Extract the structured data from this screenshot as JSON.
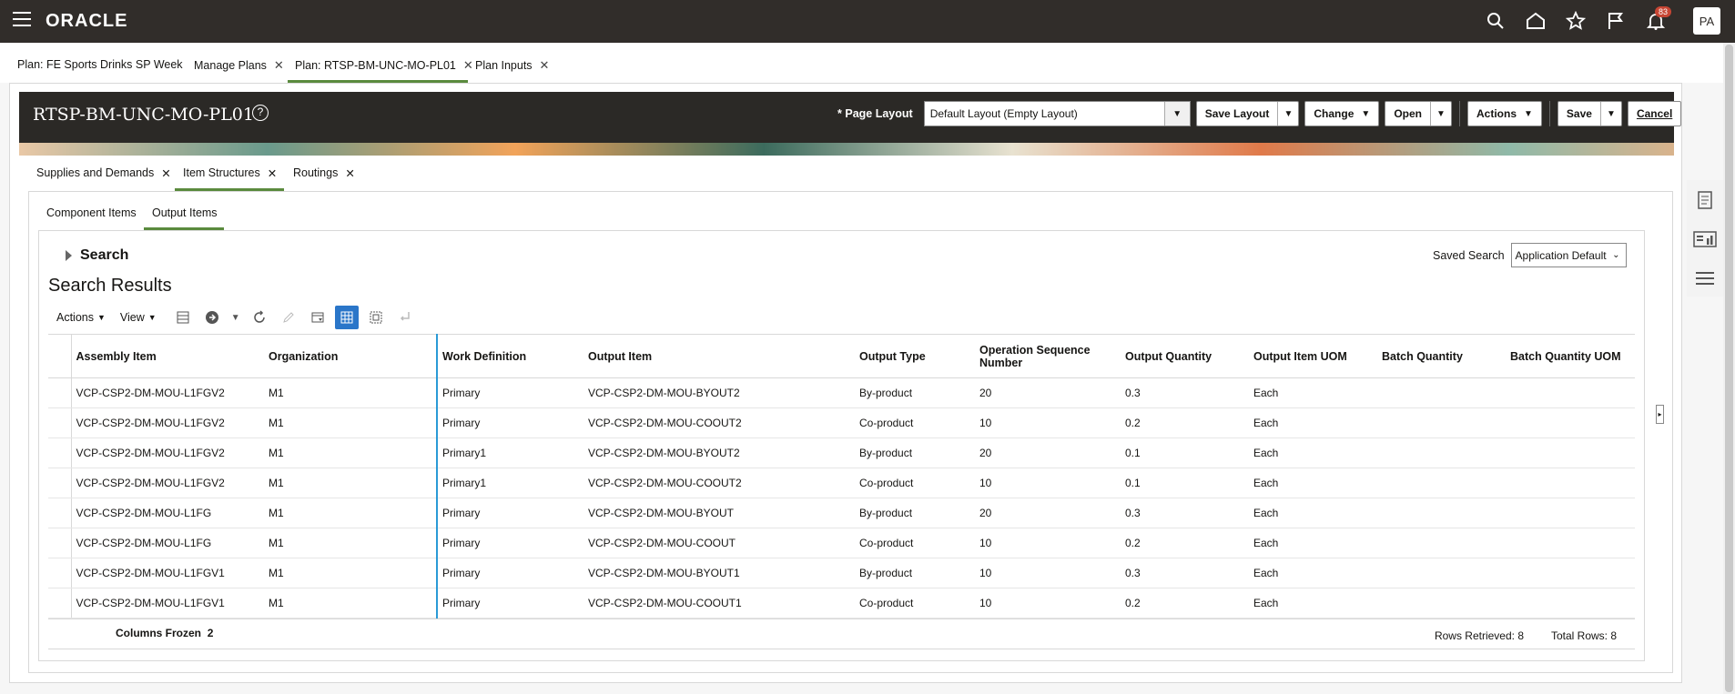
{
  "brand": "ORACLE",
  "notifications_count": "83",
  "user_initials": "PA",
  "plan_tabs": [
    {
      "label": "Plan: FE Sports Drinks SP Week",
      "closable": false
    },
    {
      "label": "Manage Plans",
      "closable": true
    },
    {
      "label": "Plan: RTSP-BM-UNC-MO-PL01",
      "closable": true
    },
    {
      "label": "Plan Inputs",
      "closable": true
    }
  ],
  "header": {
    "title": "RTSP-BM-UNC-MO-PL01",
    "page_layout_required": "*",
    "page_layout_label": "Page Layout",
    "page_layout_value": "Default Layout (Empty Layout)",
    "buttons": {
      "save_layout": "Save Layout",
      "change": "Change",
      "open": "Open",
      "actions": "Actions",
      "save": "Save",
      "cancel": "Cancel"
    }
  },
  "sub_tabs": [
    {
      "label": "Supplies and Demands"
    },
    {
      "label": "Item Structures"
    },
    {
      "label": "Routings"
    }
  ],
  "inner_tabs": [
    {
      "label": "Component Items"
    },
    {
      "label": "Output Items"
    }
  ],
  "search": {
    "label": "Search",
    "saved_search_label": "Saved Search",
    "saved_search_value": "Application Default"
  },
  "results": {
    "title": "Search Results",
    "toolbar": {
      "actions": "Actions",
      "view": "View"
    },
    "columns": [
      "Assembly Item",
      "Organization",
      "Work Definition",
      "Output Item",
      "Output Type",
      "Operation Sequence Number",
      "Output Quantity",
      "Output Item UOM",
      "Batch Quantity",
      "Batch Quantity UOM"
    ],
    "rows": [
      [
        "VCP-CSP2-DM-MOU-L1FGV2",
        "M1",
        "Primary",
        "VCP-CSP2-DM-MOU-BYOUT2",
        "By-product",
        "20",
        "0.3",
        "Each",
        "",
        ""
      ],
      [
        "VCP-CSP2-DM-MOU-L1FGV2",
        "M1",
        "Primary",
        "VCP-CSP2-DM-MOU-COOUT2",
        "Co-product",
        "10",
        "0.2",
        "Each",
        "",
        ""
      ],
      [
        "VCP-CSP2-DM-MOU-L1FGV2",
        "M1",
        "Primary1",
        "VCP-CSP2-DM-MOU-BYOUT2",
        "By-product",
        "20",
        "0.1",
        "Each",
        "",
        ""
      ],
      [
        "VCP-CSP2-DM-MOU-L1FGV2",
        "M1",
        "Primary1",
        "VCP-CSP2-DM-MOU-COOUT2",
        "Co-product",
        "10",
        "0.1",
        "Each",
        "",
        ""
      ],
      [
        "VCP-CSP2-DM-MOU-L1FG",
        "M1",
        "Primary",
        "VCP-CSP2-DM-MOU-BYOUT",
        "By-product",
        "20",
        "0.3",
        "Each",
        "",
        ""
      ],
      [
        "VCP-CSP2-DM-MOU-L1FG",
        "M1",
        "Primary",
        "VCP-CSP2-DM-MOU-COOUT",
        "Co-product",
        "10",
        "0.2",
        "Each",
        "",
        ""
      ],
      [
        "VCP-CSP2-DM-MOU-L1FGV1",
        "M1",
        "Primary",
        "VCP-CSP2-DM-MOU-BYOUT1",
        "By-product",
        "10",
        "0.3",
        "Each",
        "",
        ""
      ],
      [
        "VCP-CSP2-DM-MOU-L1FGV1",
        "M1",
        "Primary",
        "VCP-CSP2-DM-MOU-COOUT1",
        "Co-product",
        "10",
        "0.2",
        "Each",
        "",
        ""
      ]
    ],
    "columns_frozen_label": "Columns Frozen",
    "columns_frozen_value": "2",
    "rows_retrieved": "Rows Retrieved: 8",
    "total_rows": "Total Rows: 8"
  },
  "colors": {
    "topbar": "#312d2a",
    "tab_underline": "#5a8a3d",
    "accent_blue": "#2a76c9",
    "badge": "#c74634"
  }
}
